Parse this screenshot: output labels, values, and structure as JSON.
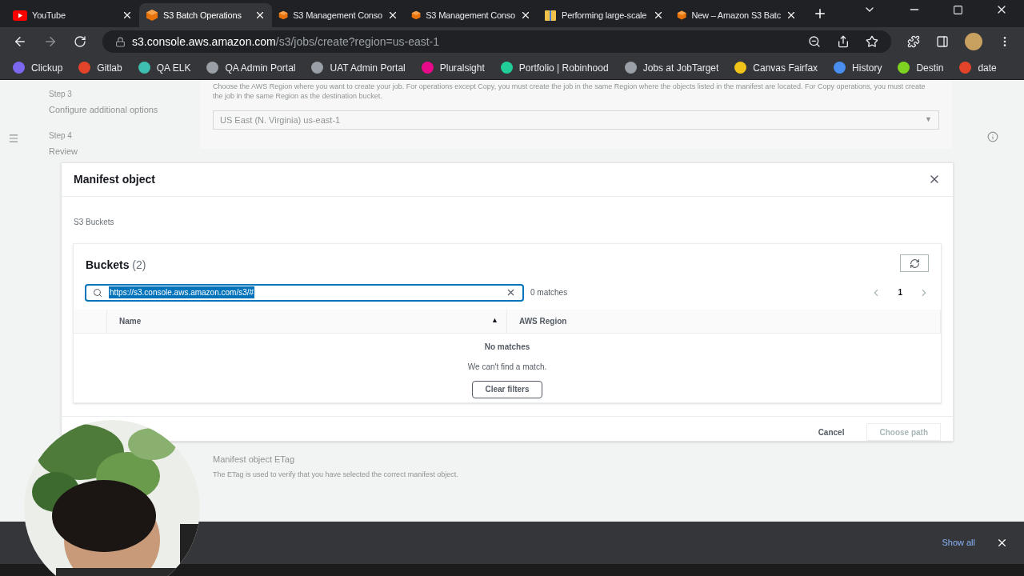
{
  "tabs": [
    {
      "title": "YouTube",
      "kind": "youtube",
      "selected": false
    },
    {
      "title": "S3 Batch Operations",
      "kind": "cube",
      "selected": true
    },
    {
      "title": "S3 Management Conso",
      "kind": "cube",
      "selected": false
    },
    {
      "title": "S3 Management Conso",
      "kind": "cube",
      "selected": false
    },
    {
      "title": "Performing large-scale",
      "kind": "box",
      "selected": false
    },
    {
      "title": "New – Amazon S3 Batc",
      "kind": "cube",
      "selected": false
    }
  ],
  "address": {
    "host": "s3.console.aws.amazon.com",
    "path": "/s3/jobs/create?region=us-east-1"
  },
  "bookmarks": [
    {
      "label": "Clickup",
      "color": "#7b68ee"
    },
    {
      "label": "Gitlab",
      "color": "#e24329"
    },
    {
      "label": "QA ELK",
      "color": "#3ebeb0"
    },
    {
      "label": "QA Admin Portal",
      "color": "#9aa0a6"
    },
    {
      "label": "UAT Admin Portal",
      "color": "#9aa0a6"
    },
    {
      "label": "Pluralsight",
      "color": "#e80a89"
    },
    {
      "label": "Portfolio | Robinhood",
      "color": "#21ce99"
    },
    {
      "label": "Jobs at JobTarget",
      "color": "#9aa0a6"
    },
    {
      "label": "Canvas Fairfax",
      "color": "#f0c419"
    },
    {
      "label": "History",
      "color": "#4a8ef0"
    },
    {
      "label": "Destin",
      "color": "#7ed321"
    },
    {
      "label": "date",
      "color": "#e24329"
    }
  ],
  "background": {
    "steps": [
      {
        "step": "Step 3",
        "label": "Configure additional options"
      },
      {
        "step": "Step 4",
        "label": "Review"
      }
    ],
    "region_note": "Choose the AWS Region where you want to create your job. For operations except Copy, you must create the job in the same Region where the objects listed in the manifest are located. For Copy operations, you must create the job in the same Region as the destination bucket.",
    "region_select": "US East (N. Virginia) us-east-1",
    "region_select_arrow": "▼",
    "etag_label": "Manifest object ETag",
    "etag_hint": "The ETag is used to verify that you have selected the correct manifest object."
  },
  "modal": {
    "title": "Manifest object",
    "breadcrumb": "S3 Buckets",
    "panel_title": "Buckets",
    "count": "(2)",
    "search": {
      "value": "https://s3.console.aws.amazon.com/s3/#"
    },
    "matches": "0 matches",
    "page": "1",
    "columns": [
      {
        "label": "Name",
        "sort_indicator": "▲"
      },
      {
        "label": "AWS Region"
      }
    ],
    "empty_title": "No matches",
    "empty_text": "We can't find a match.",
    "clear_button": "Clear filters",
    "cancel": "Cancel",
    "choose": {
      "label": "Choose path",
      "disabled": true
    }
  },
  "download_bar": {
    "show_all": "Show all"
  }
}
